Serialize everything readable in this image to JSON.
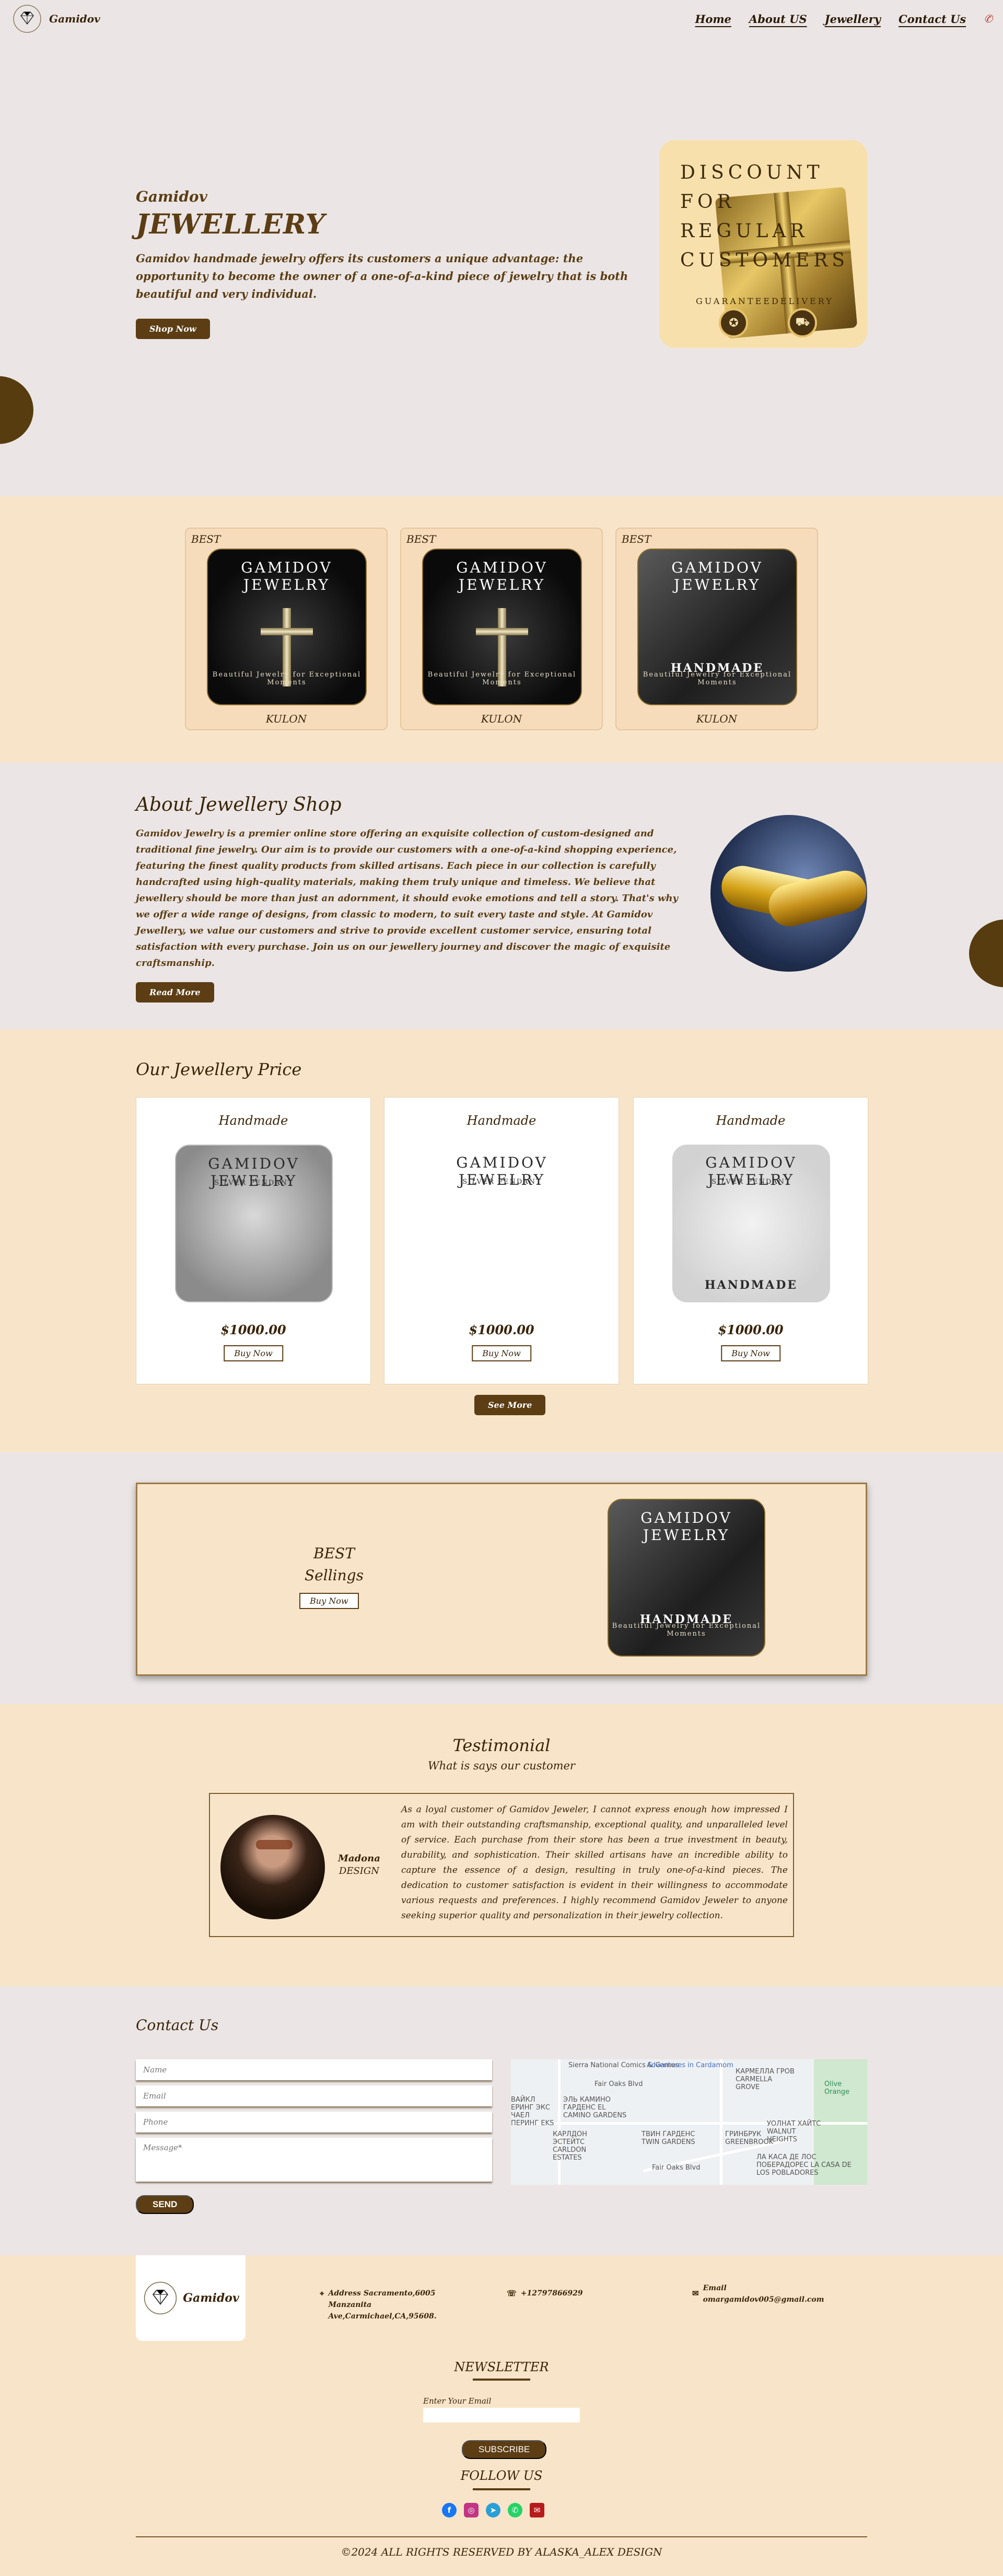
{
  "nav": {
    "brand": "Gamidov",
    "links": [
      "Home",
      "About US",
      "Jewellery",
      "Contact Us"
    ],
    "phone_icon": "phone-icon"
  },
  "hero": {
    "subtitle": "Gamidov",
    "title": "JEWELLERY",
    "description": "Gamidov handmade jewelry offers its customers a unique advantage: the opportunity to become the owner of a one-of-a-kind piece of jewelry that is both beautiful and very individual.",
    "button": "Shop Now",
    "promo_card": {
      "text": "DISCOUNT FOR REGULAR CUSTOMERS",
      "badge_left": "GUARANTEE",
      "badge_right": "DELIVERY"
    }
  },
  "best_sellers": [
    {
      "label": "BEST",
      "name": "KULON",
      "image_title": "GAMIDOV JEWELRY",
      "tagline": "Beautiful Jewelry for Exceptional Moments"
    },
    {
      "label": "BEST",
      "name": "KULON",
      "image_title": "GAMIDOV JEWELRY",
      "tagline": "Beautiful Jewelry for Exceptional Moments"
    },
    {
      "label": "BEST",
      "name": "KULON",
      "image_title": "GAMIDOV JEWELRY",
      "tagline": "Beautiful Jewelry for Exceptional Moments",
      "badge": "HANDMADE"
    }
  ],
  "about": {
    "title": "About Jewellery Shop",
    "text": "Gamidov Jewelry is a premier online store offering an exquisite collection of custom-designed and traditional fine jewelry. Our aim is to provide our customers with a one-of-a-kind shopping experience, featuring the finest quality products from skilled artisans. Each piece in our collection is carefully handcrafted using high-quality materials, making them truly unique and timeless. We believe that jewellery should be more than just an adornment, it should evoke emotions and tell a story. That's why we offer a wide range of designs, from classic to modern, to suit every taste and style. At Gamidov Jewellery, we value our customers and strive to provide excellent customer service, ensuring total satisfaction with every purchase. Join us on our jewellery journey and discover the magic of exquisite craftsmanship.",
    "button": "Read More"
  },
  "price_section": {
    "title": "Our Jewellery Price",
    "cards": [
      {
        "title": "Handmade",
        "price": "$1000.00",
        "button": "Buy Now",
        "image_title": "GAMIDOV JEWELRY",
        "image_sub": "SILVER PENDANT"
      },
      {
        "title": "Handmade",
        "price": "$1000.00",
        "button": "Buy Now",
        "image_title": "GAMIDOV JEWELRY",
        "image_sub": "SILVER PENDANT"
      },
      {
        "title": "Handmade",
        "price": "$1000.00",
        "button": "Buy Now",
        "image_title": "GAMIDOV JEWELRY",
        "image_sub": "SILVER PENDANT",
        "badge": "HANDMADE"
      }
    ],
    "see_more": "See More"
  },
  "promo": {
    "line1": "BEST",
    "line2": "Sellings",
    "button": "Buy Now",
    "image_title": "GAMIDOV JEWELRY",
    "image_badge": "HANDMADE",
    "tagline": "Beautiful Jewelry for Exceptional Moments"
  },
  "testimonial": {
    "title": "Testimonial",
    "subtitle": "What is says our customer",
    "name": "Madona",
    "role": "DESIGN",
    "text": "As a loyal customer of Gamidov Jeweler, I cannot express enough how impressed I am with their outstanding craftsmanship, exceptional quality, and unparalleled level of service. Each purchase from their store has been a true investment in beauty, durability, and sophistication. Their skilled artisans have an incredible ability to capture the essence of a design, resulting in truly one-of-a-kind pieces. The dedication to customer satisfaction is evident in their willingness to accommodate various requests and preferences. I highly recommend Gamidov Jeweler to anyone seeking superior quality and personalization in their jewelry collection."
  },
  "contact": {
    "title": "Contact Us",
    "placeholders": {
      "name": "Name",
      "email": "Email",
      "phone": "Phone",
      "message": "Message*"
    },
    "button": "SEND",
    "map_labels": [
      "Sierra National Comics & Games",
      "Adventures in Cardamom",
      "КАРМЕЛЛА ГРОВ CARMELLA GROVE",
      "ЭЛЬ КАМИНО ГАРДЕНС EL CAMINO GARDENS",
      "ВАЙКЛ ЕРИНГ ЭКС ЧАЕЛ ПЕРИНГ EKS",
      "КАРЛДОН ЭСТЕЙТС CARLDON ESTATES",
      "УОЛНАТ ХАЙТС WALNUT HEIGHTS",
      "ТВИН ГАРДЕНС TWIN GARDENS",
      "ГРИНБРУК GREENBROOK",
      "ЛА КАСА ДЕ ЛОС ПОБЕРАДОРЕС LA CASA DE LOS POBLADORES",
      "Fair Oaks Blvd",
      "Olive Orange",
      "Fair Oaks Blvd"
    ]
  },
  "footer": {
    "brand": "Gamidov",
    "address": "Address Sacramento,6005 Manzanita Ave,Carmichael,CA,95608.",
    "phone": "+12797866929",
    "email_label": "Email",
    "email": "omargamidov005@gmail.com",
    "newsletter_title": "NEWSLETTER",
    "newsletter_label": "Enter Your Email",
    "subscribe": "SUBSCRIBE",
    "follow_title": "FOLLOW US",
    "socials": [
      "facebook-icon",
      "instagram-icon",
      "telegram-icon",
      "whatsapp-icon",
      "email-icon"
    ],
    "copyright": "©2024 ALL RIGHTS RESERVED BY ALASKA_ALEX DESIGN"
  },
  "colors": {
    "brown": "#5c3d14",
    "peach": "#f8e5c9",
    "grey": "#ebe6e5",
    "facebook": "#1877f2",
    "instagram": "#c13584",
    "telegram": "#2a9fd6",
    "whatsapp": "#25d366",
    "mail": "#b71c1c"
  }
}
